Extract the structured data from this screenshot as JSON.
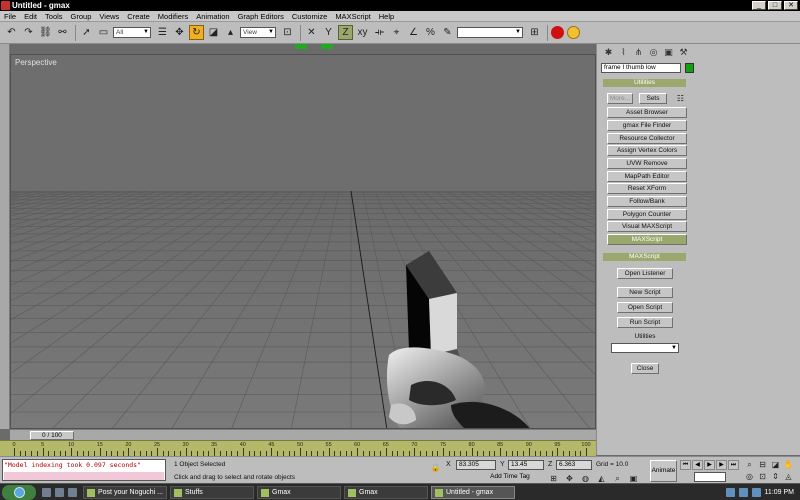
{
  "window": {
    "title": "Untitled - gmax",
    "controls": [
      "_",
      "□",
      "✕"
    ]
  },
  "menu": [
    "File",
    "Edit",
    "Tools",
    "Group",
    "Views",
    "Create",
    "Modifiers",
    "Animation",
    "Graph Editors",
    "Customize",
    "MAXScript",
    "Help"
  ],
  "toolbar": {
    "selection_filter": "All",
    "reference_coord": "View",
    "named_selection": ""
  },
  "viewport": {
    "label": "Perspective"
  },
  "command_panel": {
    "object_name": "frame I thumb low",
    "object_color": "#12a012",
    "utilities_header": "Utilities",
    "more_button": "More...",
    "sets_button": "Sets",
    "utilities": [
      "Asset Browser",
      "gmax File Finder",
      "Resource Collector",
      "Assign Vertex Colors",
      "UVW Remove",
      "MapPath Editor",
      "Reset XForm",
      "Follow/Bank",
      "Polygon Counter",
      "Visual MAXScript",
      "MAXScript"
    ],
    "active_utility": "MAXScript",
    "maxscript": {
      "header": "MAXScript",
      "open_listener": "Open Listener",
      "new_script": "New Script",
      "open_script": "Open Script",
      "run_script": "Run Script",
      "utilities_label": "Utilities",
      "close": "Close"
    }
  },
  "timeline": {
    "slider_label": "0 / 100",
    "ticks": [
      0,
      5,
      10,
      15,
      20,
      25,
      30,
      35,
      40,
      45,
      50,
      55,
      60,
      65,
      70,
      75,
      80,
      85,
      90,
      95,
      100
    ]
  },
  "status": {
    "listener_text": "\"Model indexing took 0.097 seconds\"",
    "selection": "1 Object Selected",
    "prompt": "Click and drag to select and rotate objects",
    "x_label": "X",
    "y_label": "Y",
    "z_label": "Z",
    "x": "83.305",
    "y": "13.45",
    "z": "6.363",
    "grid": "Grid = 10.0",
    "add_time_tag": "Add Time Tag",
    "animate": "Animate"
  },
  "taskbar": {
    "tasks": [
      "Post your Noguchi ...",
      "Stuffs",
      "Gmax",
      "Gmax",
      "Untitled - gmax"
    ],
    "active_task": 4,
    "clock": "11:09 PM"
  }
}
